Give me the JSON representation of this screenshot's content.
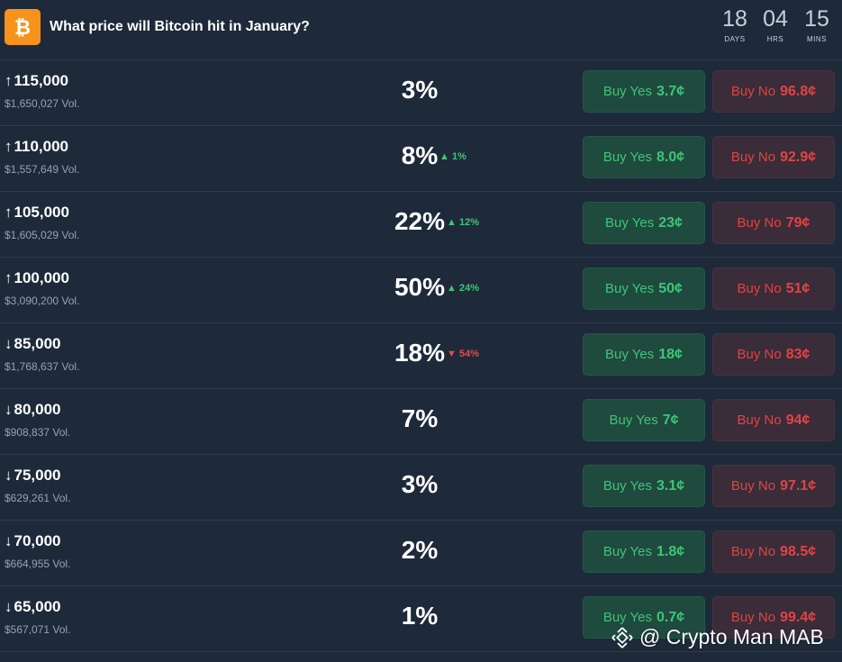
{
  "header": {
    "title": "What price will Bitcoin hit in January?",
    "countdown": [
      {
        "value": "18",
        "unit": "DAYS"
      },
      {
        "value": "04",
        "unit": "HRS"
      },
      {
        "value": "15",
        "unit": "MINS"
      }
    ]
  },
  "rows": [
    {
      "arrow": "↑",
      "strike": "115,000",
      "volume": "$1,650,027 Vol.",
      "probability": "3%",
      "change": "",
      "change_dir": "",
      "yes_label": "Buy Yes",
      "yes_price": "3.7¢",
      "no_label": "Buy No",
      "no_price": "96.8¢"
    },
    {
      "arrow": "↑",
      "strike": "110,000",
      "volume": "$1,557,649 Vol.",
      "probability": "8%",
      "change": "1%",
      "change_dir": "up",
      "yes_label": "Buy Yes",
      "yes_price": "8.0¢",
      "no_label": "Buy No",
      "no_price": "92.9¢"
    },
    {
      "arrow": "↑",
      "strike": "105,000",
      "volume": "$1,605,029 Vol.",
      "probability": "22%",
      "change": "12%",
      "change_dir": "up",
      "yes_label": "Buy Yes",
      "yes_price": "23¢",
      "no_label": "Buy No",
      "no_price": "79¢"
    },
    {
      "arrow": "↑",
      "strike": "100,000",
      "volume": "$3,090,200 Vol.",
      "probability": "50%",
      "change": "24%",
      "change_dir": "up",
      "yes_label": "Buy Yes",
      "yes_price": "50¢",
      "no_label": "Buy No",
      "no_price": "51¢"
    },
    {
      "arrow": "↓",
      "strike": "85,000",
      "volume": "$1,768,637 Vol.",
      "probability": "18%",
      "change": "54%",
      "change_dir": "down",
      "yes_label": "Buy Yes",
      "yes_price": "18¢",
      "no_label": "Buy No",
      "no_price": "83¢"
    },
    {
      "arrow": "↓",
      "strike": "80,000",
      "volume": "$908,837 Vol.",
      "probability": "7%",
      "change": "",
      "change_dir": "",
      "yes_label": "Buy Yes",
      "yes_price": "7¢",
      "no_label": "Buy No",
      "no_price": "94¢"
    },
    {
      "arrow": "↓",
      "strike": "75,000",
      "volume": "$629,261 Vol.",
      "probability": "3%",
      "change": "",
      "change_dir": "",
      "yes_label": "Buy Yes",
      "yes_price": "3.1¢",
      "no_label": "Buy No",
      "no_price": "97.1¢"
    },
    {
      "arrow": "↓",
      "strike": "70,000",
      "volume": "$664,955 Vol.",
      "probability": "2%",
      "change": "",
      "change_dir": "",
      "yes_label": "Buy Yes",
      "yes_price": "1.8¢",
      "no_label": "Buy No",
      "no_price": "98.5¢"
    },
    {
      "arrow": "↓",
      "strike": "65,000",
      "volume": "$567,071 Vol.",
      "probability": "1%",
      "change": "",
      "change_dir": "",
      "yes_label": "Buy Yes",
      "yes_price": "0.7¢",
      "no_label": "Buy No",
      "no_price": "99.4¢"
    }
  ],
  "watermark": {
    "text": "@ Crypto Man MAB",
    "icon": "binance-icon"
  },
  "colors": {
    "background": "#1e2a3a",
    "bitcoin": "#f7931a",
    "yes": "#3fc477",
    "no": "#e04444"
  }
}
